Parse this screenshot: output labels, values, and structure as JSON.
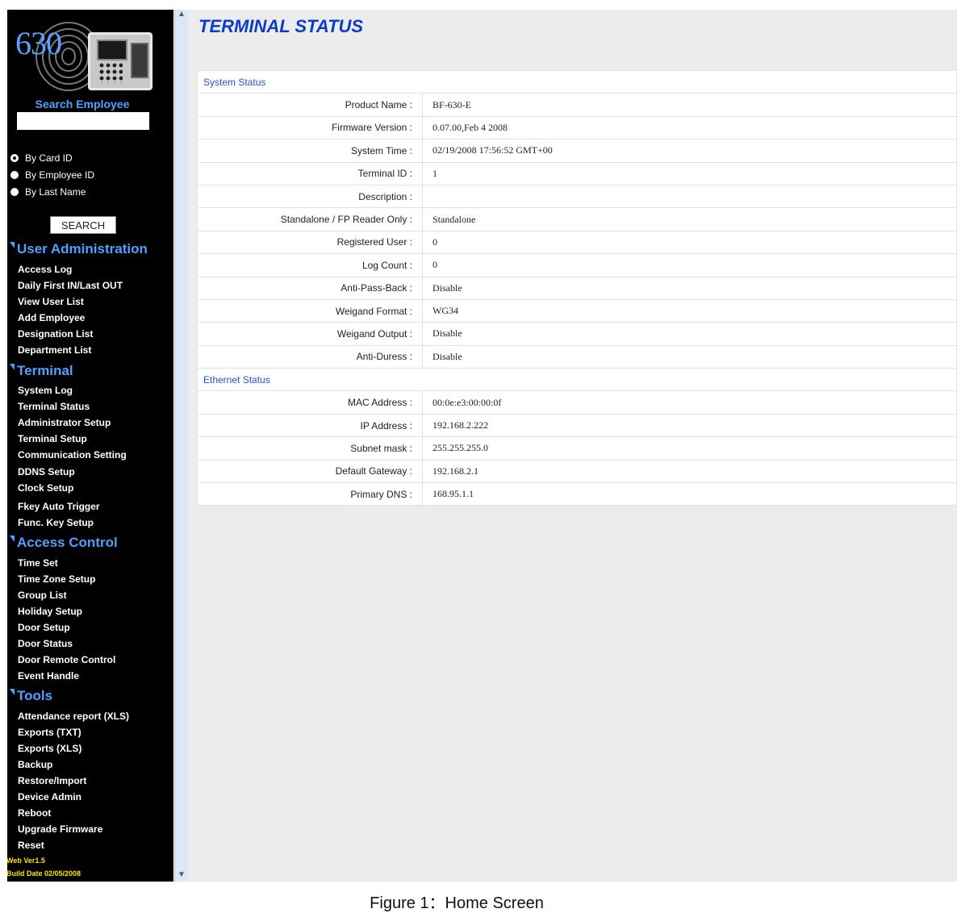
{
  "logo": {
    "number": "630"
  },
  "search": {
    "title": "Search Employee",
    "input_value": "",
    "options": [
      {
        "label": "By Card ID",
        "checked": true
      },
      {
        "label": "By Employee ID",
        "checked": false
      },
      {
        "label": "By Last Name",
        "checked": false
      }
    ],
    "button_label": "SEARCH"
  },
  "sidebar": {
    "sections": [
      {
        "title": "User Administration",
        "items": [
          "Access Log",
          "Daily First IN/Last OUT",
          "View User List",
          "Add Employee",
          "Designation List",
          "Department List"
        ]
      },
      {
        "title": "Terminal",
        "items": [
          "System Log",
          "Terminal Status",
          "Administrator Setup",
          "Terminal Setup",
          "Communication Setting",
          "DDNS Setup",
          "Clock Setup",
          "Fkey Auto Trigger",
          "Func. Key Setup"
        ]
      },
      {
        "title": "Access Control",
        "items": [
          "Time Set",
          "Time Zone Setup",
          "Group List",
          "Holiday Setup",
          "Door Setup",
          "Door Status",
          "Door Remote Control",
          "Event Handle"
        ]
      },
      {
        "title": "Tools",
        "items": [
          "Attendance report (XLS)",
          "Exports (TXT)",
          "Exports (XLS)",
          "Backup",
          "Restore/Import",
          "Device Admin",
          "Reboot",
          "Upgrade Firmware",
          "Reset"
        ]
      }
    ],
    "version": "Web Ver1.5",
    "build_date": "Build Date 02/05/2008"
  },
  "main": {
    "title": "TERMINAL STATUS",
    "system_status": {
      "heading": "System Status",
      "rows": [
        {
          "label": "Product Name :",
          "value": "BF-630-E"
        },
        {
          "label": "Firmware Version :",
          "value": "0.07.00,Feb 4 2008"
        },
        {
          "label": "System Time :",
          "value": "02/19/2008 17:56:52 GMT+00"
        },
        {
          "label": "Terminal ID :",
          "value": "1"
        },
        {
          "label": "Description :",
          "value": ""
        },
        {
          "label": "Standalone / FP Reader Only :",
          "value": "Standalone"
        },
        {
          "label": "Registered User :",
          "value": "0"
        },
        {
          "label": "Log Count :",
          "value": "0"
        },
        {
          "label": "Anti-Pass-Back :",
          "value": "Disable"
        },
        {
          "label": "Weigand Format :",
          "value": "WG34"
        },
        {
          "label": "Weigand Output :",
          "value": "Disable"
        },
        {
          "label": "Anti-Duress :",
          "value": "Disable"
        }
      ]
    },
    "ethernet_status": {
      "heading": "Ethernet Status",
      "rows": [
        {
          "label": "MAC Address :",
          "value": "00:0e:e3:00:00:0f"
        },
        {
          "label": "IP Address :",
          "value": "192.168.2.222"
        },
        {
          "label": "Subnet mask :",
          "value": "255.255.255.0"
        },
        {
          "label": "Default Gateway :",
          "value": "192.168.2.1"
        },
        {
          "label": "Primary DNS :",
          "value": "168.95.1.1"
        }
      ]
    }
  },
  "caption": "Figure 1：Home Screen",
  "colors": {
    "sidebar_bg": "#000000",
    "section_blue": "#4fa0ff",
    "title_blue": "#0a3cc8",
    "version_yellow": "#ffe600"
  }
}
